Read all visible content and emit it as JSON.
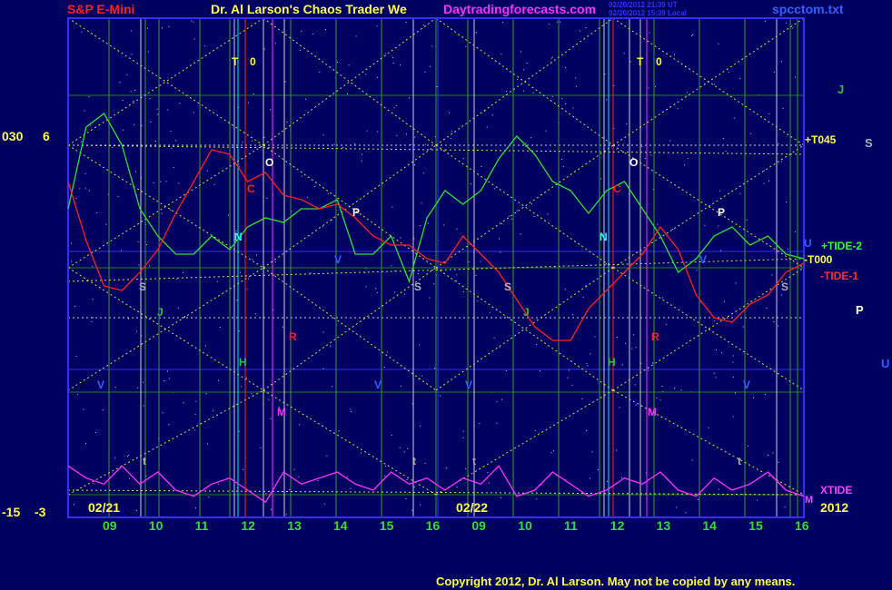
{
  "header": {
    "market": "S&P E-Mini",
    "title": "Dr. Al Larson's Chaos Trader We",
    "website": "Daytradingforecasts.com",
    "timestamp_ut": "02/20/2012 21:39 UT",
    "timestamp_local": "02/20/2012 15:39 Local",
    "file": "spcctom.txt"
  },
  "scale": {
    "top_left": "030",
    "top_right": "6",
    "bottom_left": "-15",
    "bottom_right": "-3"
  },
  "footer": {
    "copyright": "Copyright 2012, Dr. Al Larson. May not be copied by any means.",
    "year": "2012"
  },
  "colors": {
    "background": "#000060",
    "frame": "#3030ff",
    "grid": "#208020",
    "yellow_dotted": "#dddd40",
    "red": "#ff2020",
    "green": "#30e030",
    "magenta": "#ff30ff",
    "white": "#ffffff",
    "cyan": "#20e0e0"
  },
  "chart_data": {
    "type": "line",
    "days": [
      "02/21",
      "02/22"
    ],
    "hour_ticks": [
      "09",
      "10",
      "11",
      "12",
      "13",
      "14",
      "15",
      "16",
      "09",
      "10",
      "11",
      "12",
      "13",
      "14",
      "15",
      "16"
    ],
    "right_labels": [
      "J",
      "+T045",
      "S",
      "+TIDE-2",
      "-T000",
      "-TIDE-1",
      "P",
      "U",
      "XTIDE",
      "M"
    ],
    "series": [
      {
        "name": "+TIDE-2",
        "color": "green",
        "values": [
          230,
          140,
          125,
          160,
          230,
          260,
          280,
          280,
          260,
          275,
          250,
          240,
          245,
          230,
          230,
          220,
          280,
          280,
          260,
          310,
          240,
          210,
          225,
          210,
          175,
          150,
          170,
          200,
          210,
          235,
          210,
          200,
          230,
          260,
          300,
          285,
          260,
          250,
          270,
          260,
          280,
          285
        ]
      },
      {
        "name": "-TIDE-1",
        "color": "red",
        "values": [
          200,
          265,
          315,
          320,
          300,
          275,
          235,
          200,
          165,
          170,
          200,
          190,
          215,
          220,
          230,
          225,
          240,
          260,
          270,
          270,
          285,
          290,
          260,
          280,
          300,
          330,
          360,
          375,
          375,
          340,
          320,
          300,
          280,
          250,
          275,
          325,
          350,
          355,
          335,
          325,
          300,
          290
        ]
      },
      {
        "name": "XTIDE",
        "color": "magenta",
        "values": [
          -8,
          -10,
          -11,
          -8,
          -11,
          -9,
          -12,
          -13,
          -11,
          -10,
          -12,
          -14,
          -9,
          -11,
          -10,
          -9,
          -11,
          -12,
          -9,
          -11,
          -10,
          -12,
          -10,
          -11,
          -8,
          -13,
          -12,
          -9,
          -11,
          -13,
          -12,
          -10,
          -11,
          -9,
          -12,
          -13,
          -10,
          -12,
          -11,
          -9,
          -12,
          -13
        ]
      }
    ],
    "markers": [
      {
        "t": "T",
        "c": "yellow"
      },
      {
        "t": "0",
        "c": "yellow"
      },
      {
        "t": "O",
        "c": "white"
      },
      {
        "t": "C",
        "c": "red"
      },
      {
        "t": "P",
        "c": "white"
      },
      {
        "t": "N",
        "c": "cyan"
      },
      {
        "t": "S",
        "c": "gray"
      },
      {
        "t": "J",
        "c": "green"
      },
      {
        "t": "R",
        "c": "red"
      },
      {
        "t": "H",
        "c": "green"
      },
      {
        "t": "V",
        "c": "blue"
      },
      {
        "t": "V",
        "c": "blue"
      },
      {
        "t": "M",
        "c": "magenta"
      },
      {
        "t": "t",
        "c": "gray"
      },
      {
        "t": "S",
        "c": "gray"
      },
      {
        "t": "V",
        "c": "blue"
      },
      {
        "t": "t",
        "c": "gray"
      },
      {
        "t": "V",
        "c": "blue"
      },
      {
        "t": "T",
        "c": "yellow"
      },
      {
        "t": "0",
        "c": "yellow"
      },
      {
        "t": "O",
        "c": "white"
      },
      {
        "t": "C",
        "c": "red"
      },
      {
        "t": "P",
        "c": "white"
      },
      {
        "t": "N",
        "c": "cyan"
      },
      {
        "t": "S",
        "c": "gray"
      },
      {
        "t": "J",
        "c": "green"
      },
      {
        "t": "R",
        "c": "red"
      },
      {
        "t": "H",
        "c": "green"
      },
      {
        "t": "V",
        "c": "blue"
      },
      {
        "t": "M",
        "c": "magenta"
      },
      {
        "t": "t",
        "c": "gray"
      },
      {
        "t": "S",
        "c": "gray"
      },
      {
        "t": "V",
        "c": "blue"
      },
      {
        "t": "t",
        "c": "gray"
      },
      {
        "t": "U",
        "c": "blue"
      }
    ]
  }
}
